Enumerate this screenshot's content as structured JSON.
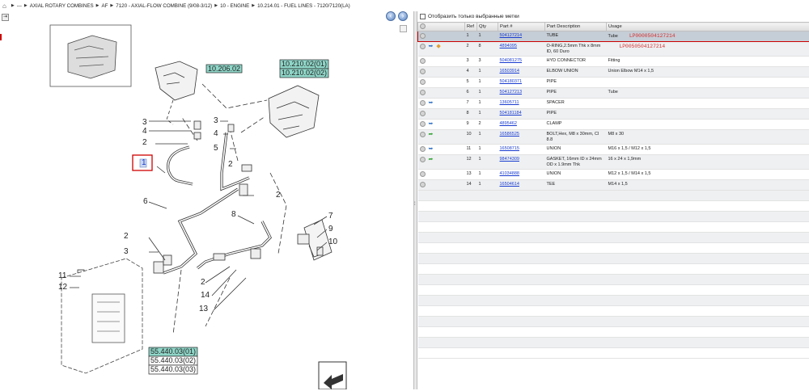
{
  "breadcrumb": {
    "items": [
      "---",
      "AXIAL ROTARY COMBINES",
      "AF",
      "7120 - AXIAL-FLOW COMBINE (9/08-3/12)",
      "10 - ENGINE",
      "10.214.01 - FUEL LINES - 7120/7120(LA)"
    ]
  },
  "diagram": {
    "refs_left": [
      "10.206.02",
      "10.210.02(01)",
      "10.210.02(02)"
    ],
    "refs_bottom": [
      "55.440.03(01)",
      "55.440.03(02)",
      "55.440.03(03)"
    ],
    "callouts": [
      "1",
      "2",
      "2",
      "2",
      "2",
      "2",
      "3",
      "3",
      "3",
      "4",
      "4",
      "5",
      "6",
      "7",
      "8",
      "9",
      "10",
      "11",
      "12",
      "13",
      "14"
    ]
  },
  "filter": {
    "label": "Отобразить только выбранные метки"
  },
  "table": {
    "columns": [
      "",
      "Ref",
      "Qty",
      "Part #",
      "Part Description",
      "Usage"
    ],
    "rows": [
      {
        "ref": "1",
        "qty": "1",
        "part": "504127214",
        "desc": "TUBE",
        "usage": "Tube",
        "lp": "LP0000504127214",
        "icons": []
      },
      {
        "ref": "2",
        "qty": "8",
        "part": "4894095",
        "desc": "O-RING,2.5mm Thk x 8mm ID, 60 Duro",
        "usage": "",
        "lp": "LP0050504127214",
        "icons": [
          "blue",
          "orange"
        ]
      },
      {
        "ref": "3",
        "qty": "3",
        "part": "504081275",
        "desc": "HYD CONNECTOR",
        "usage": "Fitting",
        "lp": "",
        "icons": []
      },
      {
        "ref": "4",
        "qty": "1",
        "part": "16503914",
        "desc": "ELBOW UNION",
        "usage": "Union Elbow M14 x 1,5",
        "lp": "",
        "icons": []
      },
      {
        "ref": "5",
        "qty": "1",
        "part": "504180371",
        "desc": "PIPE",
        "usage": "",
        "lp": "",
        "icons": []
      },
      {
        "ref": "6",
        "qty": "1",
        "part": "504127213",
        "desc": "PIPE",
        "usage": "Tube",
        "lp": "",
        "icons": []
      },
      {
        "ref": "7",
        "qty": "1",
        "part": "13605711",
        "desc": "SPACER",
        "usage": "",
        "lp": "",
        "icons": [
          "blue"
        ]
      },
      {
        "ref": "8",
        "qty": "1",
        "part": "504181184",
        "desc": "PIPE",
        "usage": "",
        "lp": "",
        "icons": []
      },
      {
        "ref": "9",
        "qty": "2",
        "part": "4895462",
        "desc": "CLAMP",
        "usage": "",
        "lp": "",
        "icons": [
          "blue"
        ]
      },
      {
        "ref": "10",
        "qty": "1",
        "part": "16586525",
        "desc": "BOLT,Hex, M8 x 30mm, Cl 8.8",
        "usage": "M8 x 30",
        "lp": "",
        "icons": [
          "green"
        ]
      },
      {
        "ref": "11",
        "qty": "1",
        "part": "16508715",
        "desc": "UNION",
        "usage": "M16 x 1,5 / M12 x 1,5",
        "lp": "",
        "icons": [
          "blue"
        ]
      },
      {
        "ref": "12",
        "qty": "1",
        "part": "98474309",
        "desc": "GASKET, 16mm ID x 24mm OD x 1.9mm Thk",
        "usage": "16 x 24 x 1,9mm",
        "lp": "",
        "icons": [
          "green"
        ]
      },
      {
        "ref": "13",
        "qty": "1",
        "part": "41034888",
        "desc": "UNION",
        "usage": "M12 x 1,5 / M14 x 1,5",
        "lp": "",
        "icons": []
      },
      {
        "ref": "14",
        "qty": "1",
        "part": "16504614",
        "desc": "TEE",
        "usage": "M14 x 1,5",
        "lp": "",
        "icons": []
      }
    ]
  }
}
